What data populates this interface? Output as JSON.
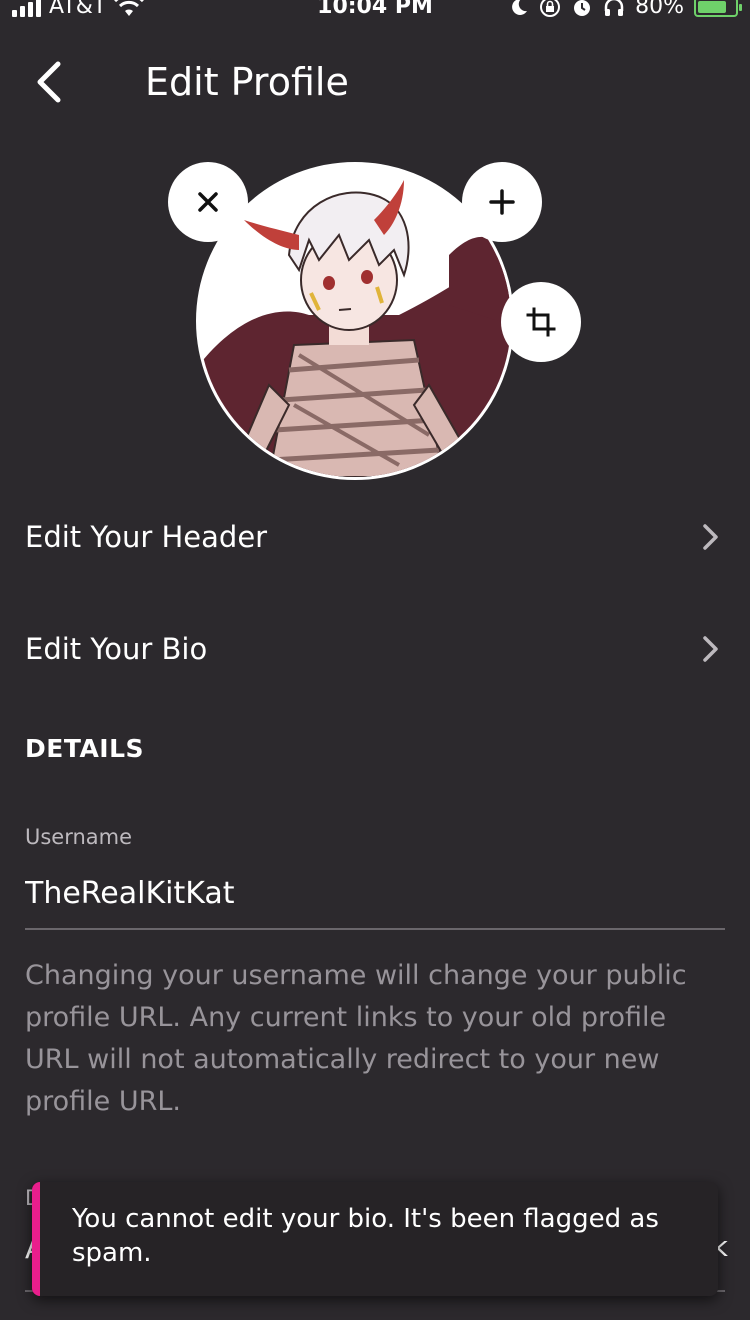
{
  "status_bar": {
    "carrier": "AT&T",
    "time": "10:04 PM",
    "battery_percent": "80%",
    "battery_level": 0.8,
    "icons": [
      "signal-icon",
      "wifi-icon",
      "moon-icon",
      "rotation-lock-icon",
      "alarm-icon",
      "headphones-icon",
      "battery-charging-icon"
    ]
  },
  "header": {
    "title": "Edit Profile"
  },
  "avatar": {
    "buttons": [
      "close-icon",
      "plus-icon",
      "crop-icon"
    ]
  },
  "menu": {
    "edit_header": "Edit Your Header",
    "edit_bio": "Edit Your Bio"
  },
  "details": {
    "title": "DETAILS",
    "username_label": "Username",
    "username_value": "TheRealKitKat",
    "help_text": "Changing your username will change your public profile URL. Any current links to your old profile URL will not automatically redirect to your new profile URL.",
    "partial_label": "D",
    "partial_value": "A"
  },
  "toast": {
    "message": "You cannot edit your bio. It's been flagged as spam.",
    "peek": "k"
  },
  "colors": {
    "background": "#2c292d",
    "toast_accent": "#e91e8c",
    "battery": "#6fd16a"
  }
}
